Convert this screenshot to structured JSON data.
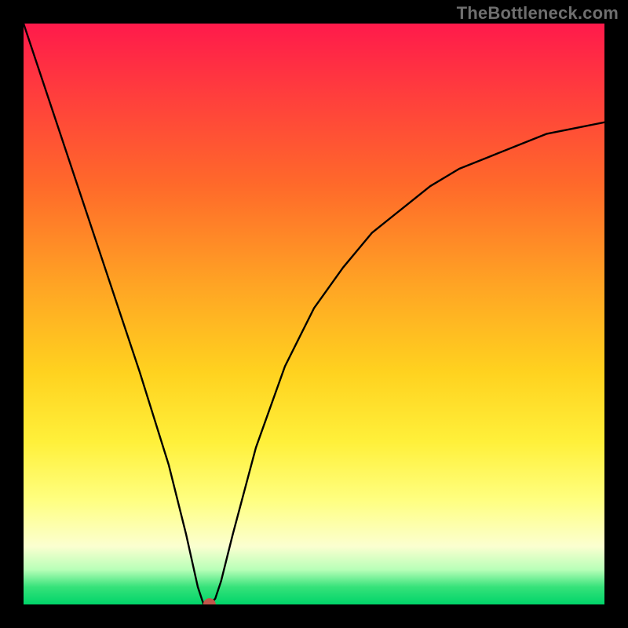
{
  "watermark": "TheBottleneck.com",
  "chart_data": {
    "type": "line",
    "title": "",
    "xlabel": "",
    "ylabel": "",
    "xlim": [
      0,
      100
    ],
    "ylim": [
      0,
      100
    ],
    "grid": false,
    "legend": false,
    "annotations": [],
    "series": [
      {
        "name": "curve",
        "x": [
          0,
          5,
          10,
          15,
          20,
          25,
          28,
          30,
          31,
          32,
          33,
          34,
          36,
          40,
          45,
          50,
          55,
          60,
          65,
          70,
          75,
          80,
          85,
          90,
          95,
          100
        ],
        "y": [
          100,
          85,
          70,
          55,
          40,
          24,
          12,
          3,
          0,
          0,
          1,
          4,
          12,
          27,
          41,
          51,
          58,
          64,
          68,
          72,
          75,
          77,
          79,
          81,
          82,
          83
        ]
      }
    ],
    "marker": {
      "x": 32,
      "y": 0,
      "color": "#c1574b"
    },
    "gradient_stops": [
      {
        "pos": 0,
        "color": "#ff1a4b"
      },
      {
        "pos": 12,
        "color": "#ff3d3d"
      },
      {
        "pos": 28,
        "color": "#ff6a2a"
      },
      {
        "pos": 45,
        "color": "#ffa424"
      },
      {
        "pos": 60,
        "color": "#ffd21f"
      },
      {
        "pos": 72,
        "color": "#fff03a"
      },
      {
        "pos": 82,
        "color": "#ffff80"
      },
      {
        "pos": 90,
        "color": "#fbffd0"
      },
      {
        "pos": 94,
        "color": "#b8ffb8"
      },
      {
        "pos": 97,
        "color": "#36e27a"
      },
      {
        "pos": 100,
        "color": "#00d469"
      }
    ]
  }
}
